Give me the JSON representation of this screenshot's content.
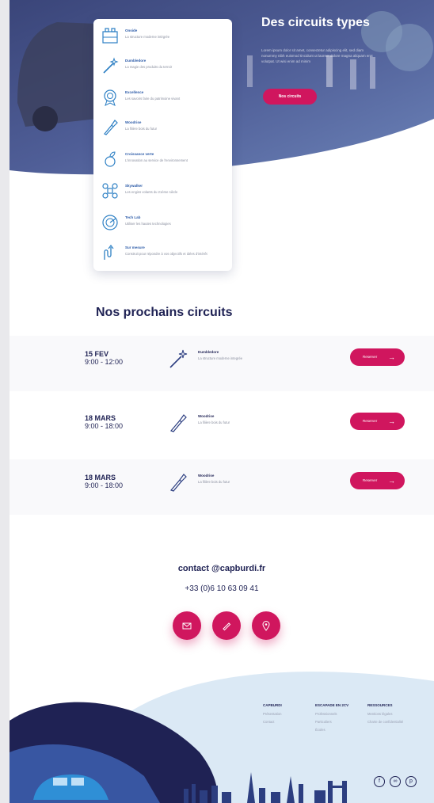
{
  "hero": {
    "title": "Des circuits types",
    "description": "Lorem ipsum dolor sit amet, consectetur adipiscing elit, sed diam nonummy nibh euismod tincidunt ut laoreet dolore magna aliquam erat volutpat. Ut wisi enim ad minim",
    "button_label": "Nos circuits"
  },
  "circuit_types": [
    {
      "name": "Onside",
      "desc": "La structure moderne intégrée",
      "icon": "building-icon"
    },
    {
      "name": "Dumbledore",
      "desc": "La magie des produits du terroir",
      "icon": "magic-wand-icon"
    },
    {
      "name": "Excellence",
      "desc": "Les savoirs faire du patrimoine vivant",
      "icon": "medal-icon"
    },
    {
      "name": "Woodrise",
      "desc": "La filière bois du futur",
      "icon": "tool-icon"
    },
    {
      "name": "Croissance verte",
      "desc": "L'innovation au service de l'environnement",
      "icon": "leaf-icon"
    },
    {
      "name": "Skywalker",
      "desc": "Les engins volants du 21ème siècle",
      "icon": "drone-icon"
    },
    {
      "name": "Tech Lab",
      "desc": "Utiliser les hautes technologies",
      "icon": "radar-icon"
    },
    {
      "name": "Sur mesure",
      "desc": "Construit pour répondre à vos objectifs et idées d'intérêt",
      "icon": "route-icon"
    }
  ],
  "upcoming": {
    "title": "Nos prochains circuits",
    "button_label": "Reserver",
    "events": [
      {
        "date": "15 FEV",
        "time": "9:00 - 12:00",
        "name": "Dumbledore",
        "desc": "La structure moderne integrée",
        "icon": "magic-wand-icon"
      },
      {
        "date": "18 MARS",
        "time": "9:00 - 18:00",
        "name": "Woodrise",
        "desc": "La filière bois du futur",
        "icon": "tool-icon"
      },
      {
        "date": "18 MARS",
        "time": "9:00 - 18:00",
        "name": "Woodrise",
        "desc": "La filière bois du futur",
        "icon": "tool-icon"
      }
    ]
  },
  "contact": {
    "email": "contact @capburdi.fr",
    "phone": "+33 (0)6 10 63 09 41",
    "buttons": [
      "mail-icon",
      "phone-icon",
      "location-icon"
    ]
  },
  "footer": {
    "columns": [
      {
        "heading": "CAPBURDI",
        "links": [
          "Présentation",
          "Contact"
        ]
      },
      {
        "heading": "ESCAPADE EN 2CV",
        "links": [
          "Professionnels",
          "Particuliers",
          "Écoles"
        ]
      },
      {
        "heading": "RESSOURCES",
        "links": [
          "Mentions légales",
          "Charte de confidentialité"
        ]
      }
    ],
    "social": [
      "facebook-icon",
      "tripadvisor-icon",
      "pinterest-icon"
    ]
  },
  "colors": {
    "accent": "#d0165e",
    "navy": "#1f2254",
    "blue": "#2c5ba8",
    "footer_light": "#dbe9f5"
  }
}
